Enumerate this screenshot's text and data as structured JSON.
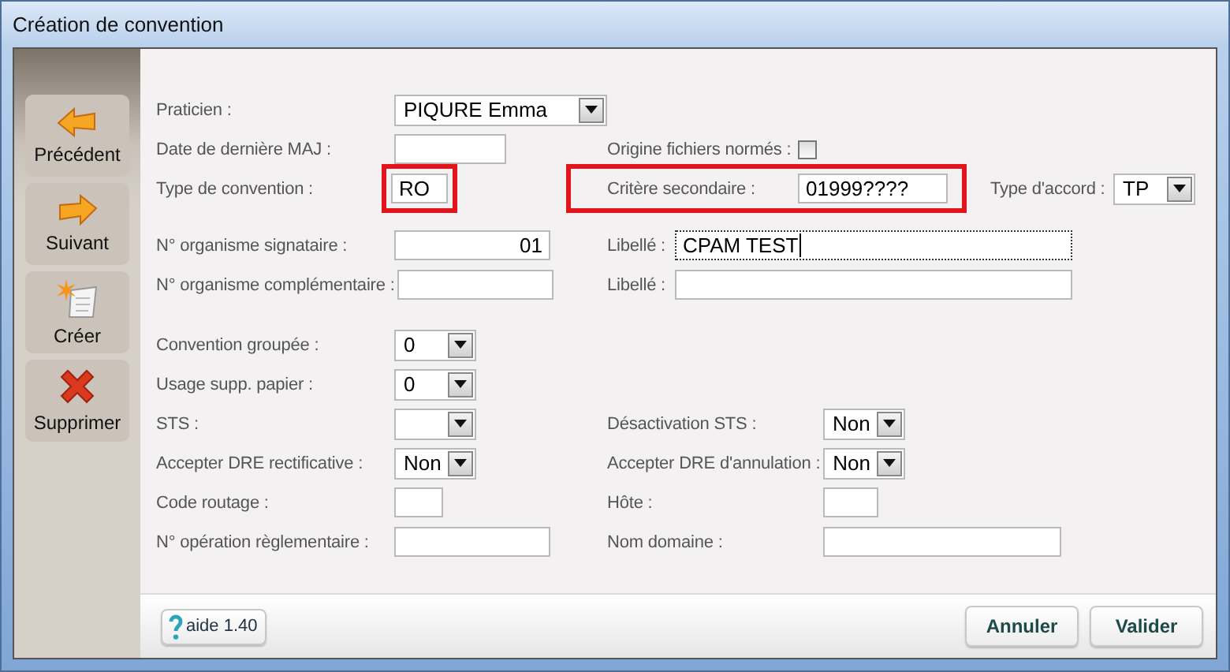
{
  "window": {
    "title": "Création de convention"
  },
  "sidebar": {
    "buttons": [
      {
        "kind": "previous",
        "label": "Précédent"
      },
      {
        "kind": "next",
        "label": "Suivant"
      },
      {
        "kind": "create",
        "label": "Créer"
      },
      {
        "kind": "delete",
        "label": "Supprimer"
      }
    ]
  },
  "form": {
    "rows": [
      [
        {
          "kind": "select",
          "label": "Praticien :",
          "value": "PIQURE Emma"
        }
      ],
      [
        {
          "kind": "text",
          "label": "Date de dernière MAJ :"
        },
        {
          "kind": "checkbox",
          "label": "Origine fichiers normés :",
          "checked": false
        }
      ],
      [
        {
          "kind": "text",
          "label": "Type de convention :",
          "value": "RO",
          "highlighted": true
        },
        {
          "kind": "text",
          "label": "Critère secondaire :",
          "value": "01999????",
          "highlighted": true
        },
        {
          "kind": "select",
          "label": "Type d'accord :",
          "value": "TP"
        }
      ],
      [
        {
          "kind": "text",
          "label": "N° organisme signataire :",
          "value": "01"
        },
        {
          "kind": "text",
          "label": "Libellé :",
          "value": "CPAM TEST",
          "focused": true
        }
      ],
      [
        {
          "kind": "text",
          "label": "N° organisme complémentaire :"
        },
        {
          "kind": "text",
          "label": "Libellé :"
        }
      ],
      [
        {
          "kind": "select",
          "label": "Convention groupée :",
          "value": "0"
        }
      ],
      [
        {
          "kind": "select",
          "label": "Usage supp. papier :",
          "value": "0"
        }
      ],
      [
        {
          "kind": "select",
          "label": "STS :"
        },
        {
          "kind": "select",
          "label": "Désactivation STS :",
          "value": "Non"
        }
      ],
      [
        {
          "kind": "select",
          "label": "Accepter DRE rectificative :",
          "value": "Non"
        },
        {
          "kind": "select",
          "label": "Accepter DRE d'annulation :",
          "value": "Non"
        }
      ],
      [
        {
          "kind": "text",
          "label": "Code routage :"
        },
        {
          "kind": "text",
          "label": "Hôte :"
        }
      ],
      [
        {
          "kind": "text",
          "label": "N° opération règlementaire :"
        },
        {
          "kind": "text",
          "label": "Nom domaine :"
        }
      ]
    ]
  },
  "footer": {
    "help": "aide 1.40",
    "buttons": [
      "Annuler",
      "Valider"
    ]
  }
}
